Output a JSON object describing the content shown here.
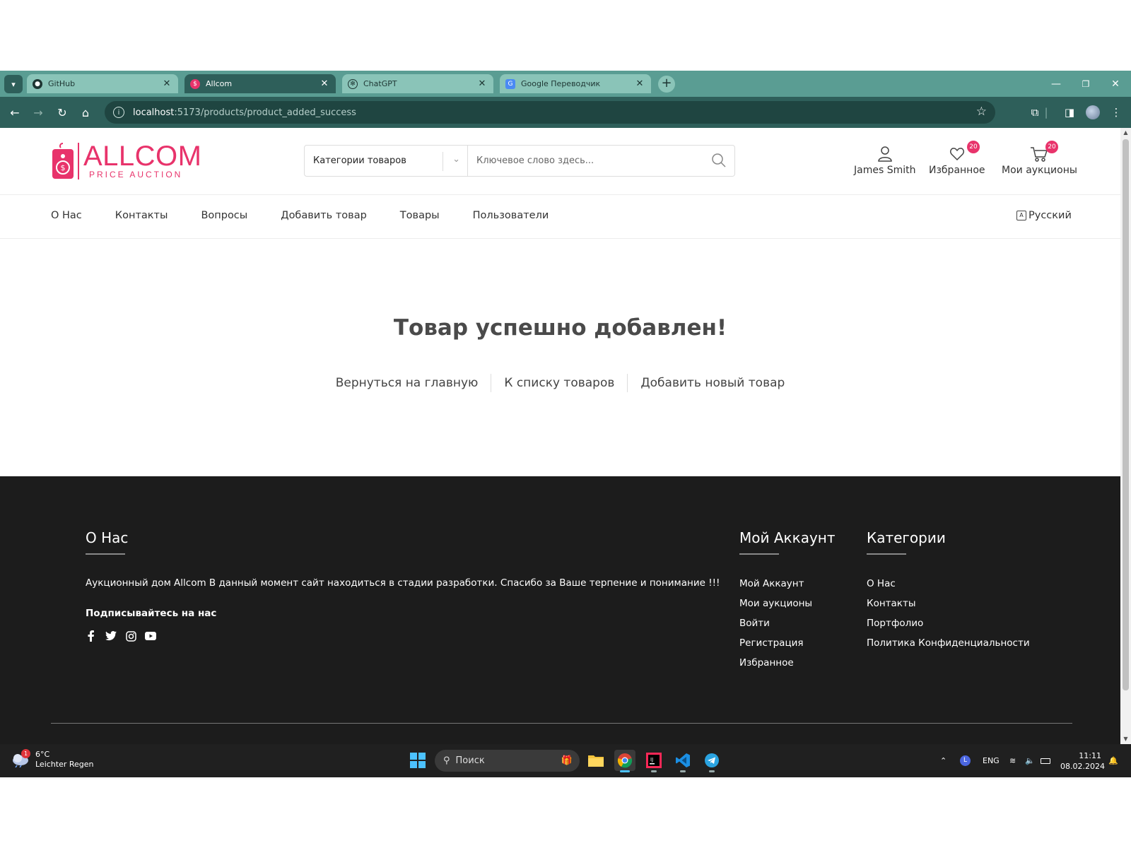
{
  "browser": {
    "tabs": [
      {
        "title": "GitHub",
        "active": false
      },
      {
        "title": "Allcom",
        "active": true
      },
      {
        "title": "ChatGPT",
        "active": false
      },
      {
        "title": "Google Переводчик",
        "active": false
      }
    ],
    "url_host": "localhost",
    "url_path": ":5173/products/product_added_success"
  },
  "header": {
    "logo_main": "ALLCOM",
    "logo_sub": "PRICE AUCTION",
    "category_select": "Категории товаров",
    "search_placeholder": "Ключевое слово здесь...",
    "user_name": "James Smith",
    "favorites_label": "Избранное",
    "favorites_count": "20",
    "auctions_label": "Мои аукционы",
    "auctions_count": "20"
  },
  "nav": {
    "items": [
      "О Нас",
      "Контакты",
      "Вопросы",
      "Добавить товар",
      "Товары",
      "Пользователи"
    ],
    "language": "Русский"
  },
  "main": {
    "title": "Товар успешно добавлен!",
    "links": [
      "Вернуться на главную",
      "К списку товаров",
      "Добавить новый товар"
    ]
  },
  "footer": {
    "about_heading": "О Нас",
    "about_text": "Аукционный дом Allcom В данный момент сайт находиться в стадии разработки. Спасибо за Ваше терпение и понимание !!!",
    "subscribe": "Подписывайтесь на нас",
    "account_heading": "Мой Аккаунт",
    "account_links": [
      "Мой Аккаунт",
      "Мои аукционы",
      "Войти",
      "Регистрация",
      "Избранное"
    ],
    "categories_heading": "Категории",
    "categories_links": [
      "О Нас",
      "Контакты",
      "Портфолио",
      "Политика Конфиденциальности"
    ]
  },
  "taskbar": {
    "temperature": "6°C",
    "weather": "Leichter Regen",
    "weather_badge": "1",
    "search": "Поиск",
    "lang": "ENG",
    "time": "11:11",
    "date": "08.02.2024"
  },
  "colors": {
    "brand": "#e8336b",
    "browser_frame": "#2e5f5a",
    "footer_bg": "#1c1c1c"
  }
}
